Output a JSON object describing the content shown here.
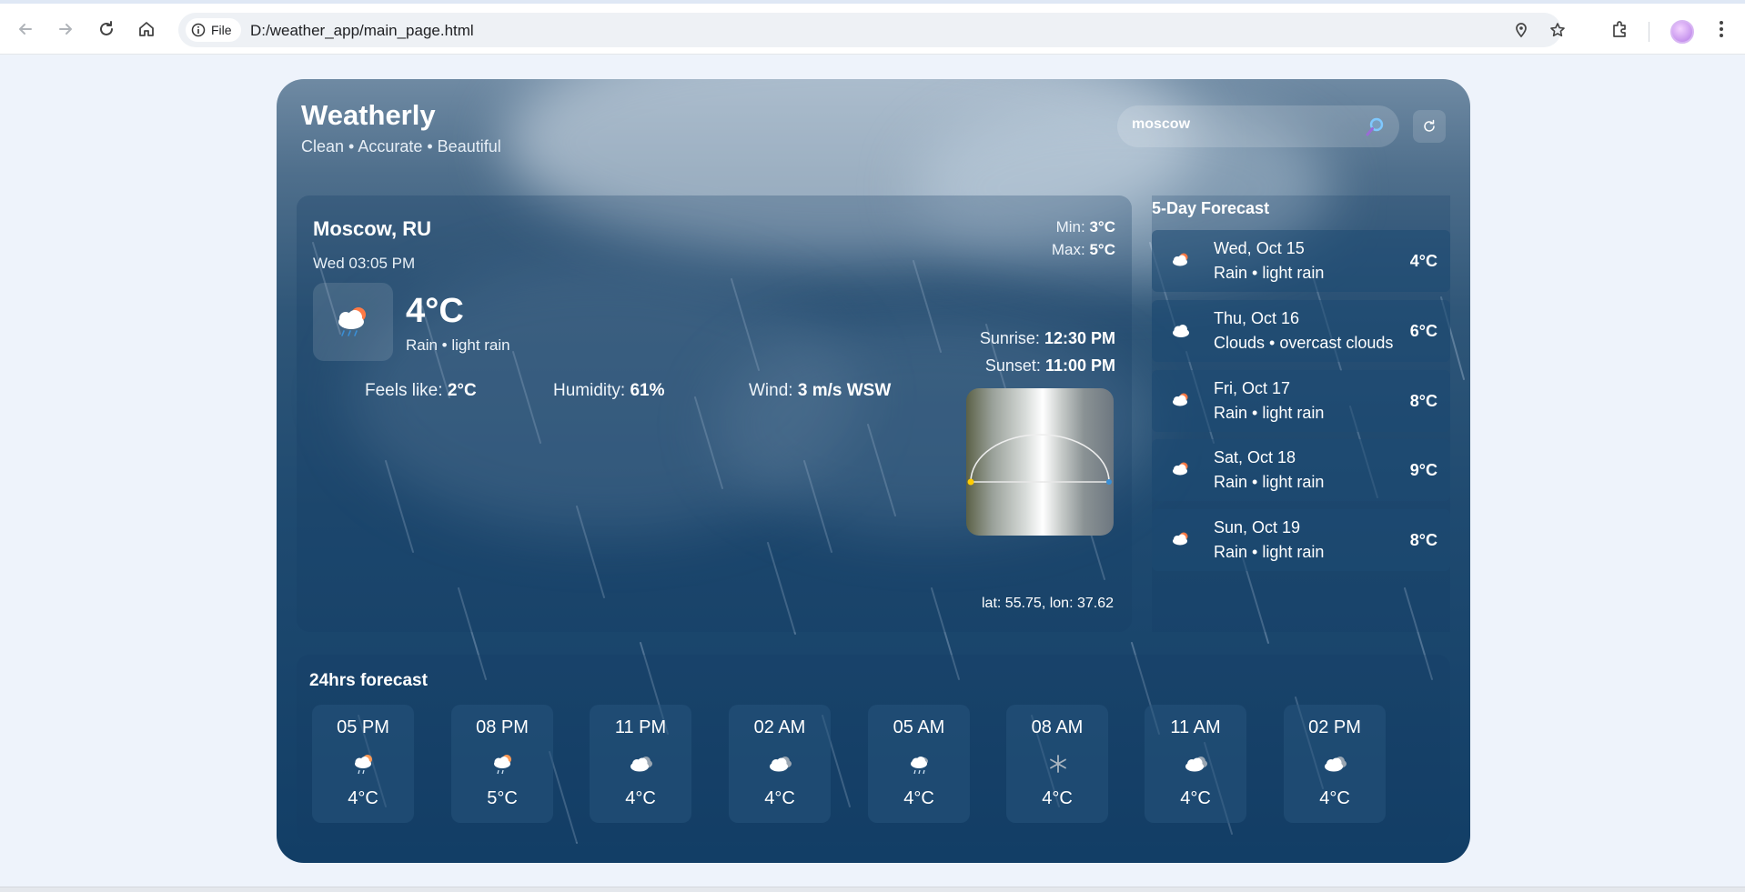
{
  "browser": {
    "url": "D:/weather_app/main_page.html",
    "chip_label": "File"
  },
  "app": {
    "brand": "Weatherly",
    "tagline": "Clean • Accurate • Beautiful",
    "search_value": "moscow"
  },
  "current": {
    "city": "Moscow, RU",
    "datetime": "Wed 03:05 PM",
    "temp": "4°C",
    "desc": "Rain • light rain",
    "min_label": "Min:",
    "min": "3°C",
    "max_label": "Max:",
    "max": "5°C",
    "feels_label": "Feels like:",
    "feels": "2°C",
    "humidity_label": "Humidity:",
    "humidity": "61%",
    "wind_label": "Wind:",
    "wind": "3 m/s WSW",
    "sunrise_label": "Sunrise:",
    "sunrise": "12:30 PM",
    "sunset_label": "Sunset:",
    "sunset": "11:00 PM",
    "latlon": "lat: 55.75, lon: 37.62"
  },
  "fiveday": {
    "title": "5-Day Forecast",
    "items": [
      {
        "date": "Wed, Oct 15",
        "desc": "Rain • light rain",
        "temp": "4°C",
        "icon": "rain-sun-icon"
      },
      {
        "date": "Thu, Oct 16",
        "desc": "Clouds • overcast clouds",
        "temp": "6°C",
        "icon": "cloud-icon"
      },
      {
        "date": "Fri, Oct 17",
        "desc": "Rain • light rain",
        "temp": "8°C",
        "icon": "rain-sun-icon"
      },
      {
        "date": "Sat, Oct 18",
        "desc": "Rain • light rain",
        "temp": "9°C",
        "icon": "rain-sun-icon"
      },
      {
        "date": "Sun, Oct 19",
        "desc": "Rain • light rain",
        "temp": "8°C",
        "icon": "rain-sun-icon"
      }
    ]
  },
  "hourly": {
    "title": "24hrs forecast",
    "items": [
      {
        "time": "05 PM",
        "temp": "4°C",
        "icon": "rain-sun-icon"
      },
      {
        "time": "08 PM",
        "temp": "5°C",
        "icon": "rain-sun-icon"
      },
      {
        "time": "11 PM",
        "temp": "4°C",
        "icon": "clouds-icon"
      },
      {
        "time": "02 AM",
        "temp": "4°C",
        "icon": "clouds-icon"
      },
      {
        "time": "05 AM",
        "temp": "4°C",
        "icon": "rain-cloud-icon"
      },
      {
        "time": "08 AM",
        "temp": "4°C",
        "icon": "snowflake-icon"
      },
      {
        "time": "11 AM",
        "temp": "4°C",
        "icon": "clouds-icon"
      },
      {
        "time": "02 PM",
        "temp": "4°C",
        "icon": "clouds-icon"
      }
    ]
  }
}
